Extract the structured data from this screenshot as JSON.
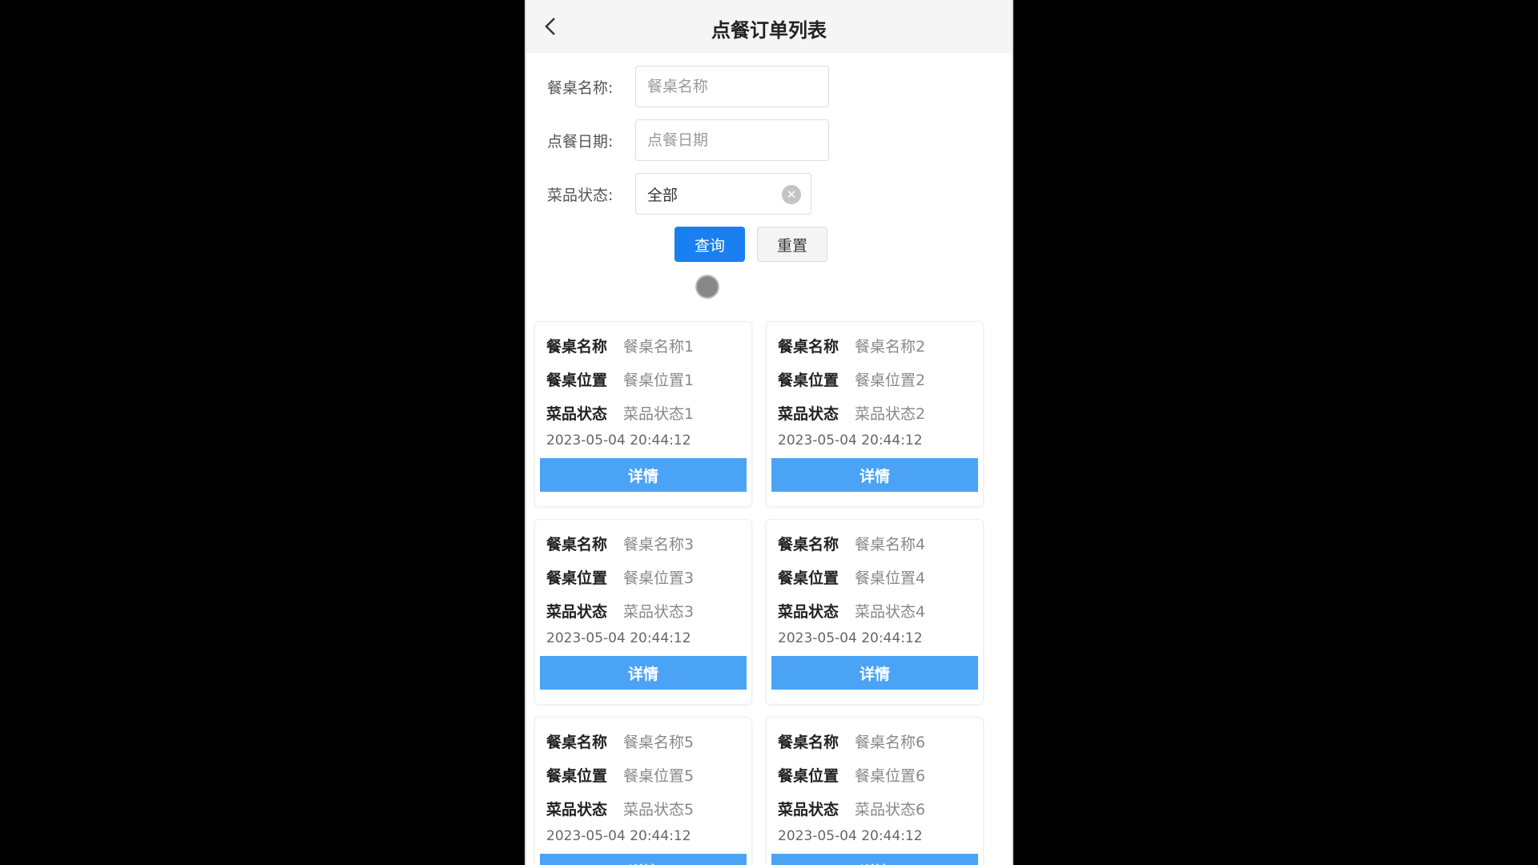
{
  "header": {
    "title": "点餐订单列表",
    "back_icon": "chevron-left-icon"
  },
  "form": {
    "table_name_label": "餐桌名称:",
    "table_name_placeholder": "餐桌名称",
    "date_label": "点餐日期:",
    "date_placeholder": "点餐日期",
    "status_label": "菜品状态:",
    "status_value": "全部",
    "query_button": "查询",
    "reset_button": "重置"
  },
  "card_labels": {
    "name": "餐桌名称",
    "position": "餐桌位置",
    "status": "菜品状态",
    "detail": "详情"
  },
  "orders": [
    {
      "name": "餐桌名称1",
      "position": "餐桌位置1",
      "status": "菜品状态1",
      "time": "2023-05-04 20:44:12"
    },
    {
      "name": "餐桌名称2",
      "position": "餐桌位置2",
      "status": "菜品状态2",
      "time": "2023-05-04 20:44:12"
    },
    {
      "name": "餐桌名称3",
      "position": "餐桌位置3",
      "status": "菜品状态3",
      "time": "2023-05-04 20:44:12"
    },
    {
      "name": "餐桌名称4",
      "position": "餐桌位置4",
      "status": "菜品状态4",
      "time": "2023-05-04 20:44:12"
    },
    {
      "name": "餐桌名称5",
      "position": "餐桌位置5",
      "status": "菜品状态5",
      "time": "2023-05-04 20:44:12"
    },
    {
      "name": "餐桌名称6",
      "position": "餐桌位置6",
      "status": "菜品状态6",
      "time": "2023-05-04 20:44:12"
    }
  ],
  "colors": {
    "primary": "#1a7ff0",
    "detail_button": "#4ba3f6",
    "header_bg": "#f5f5f5"
  }
}
